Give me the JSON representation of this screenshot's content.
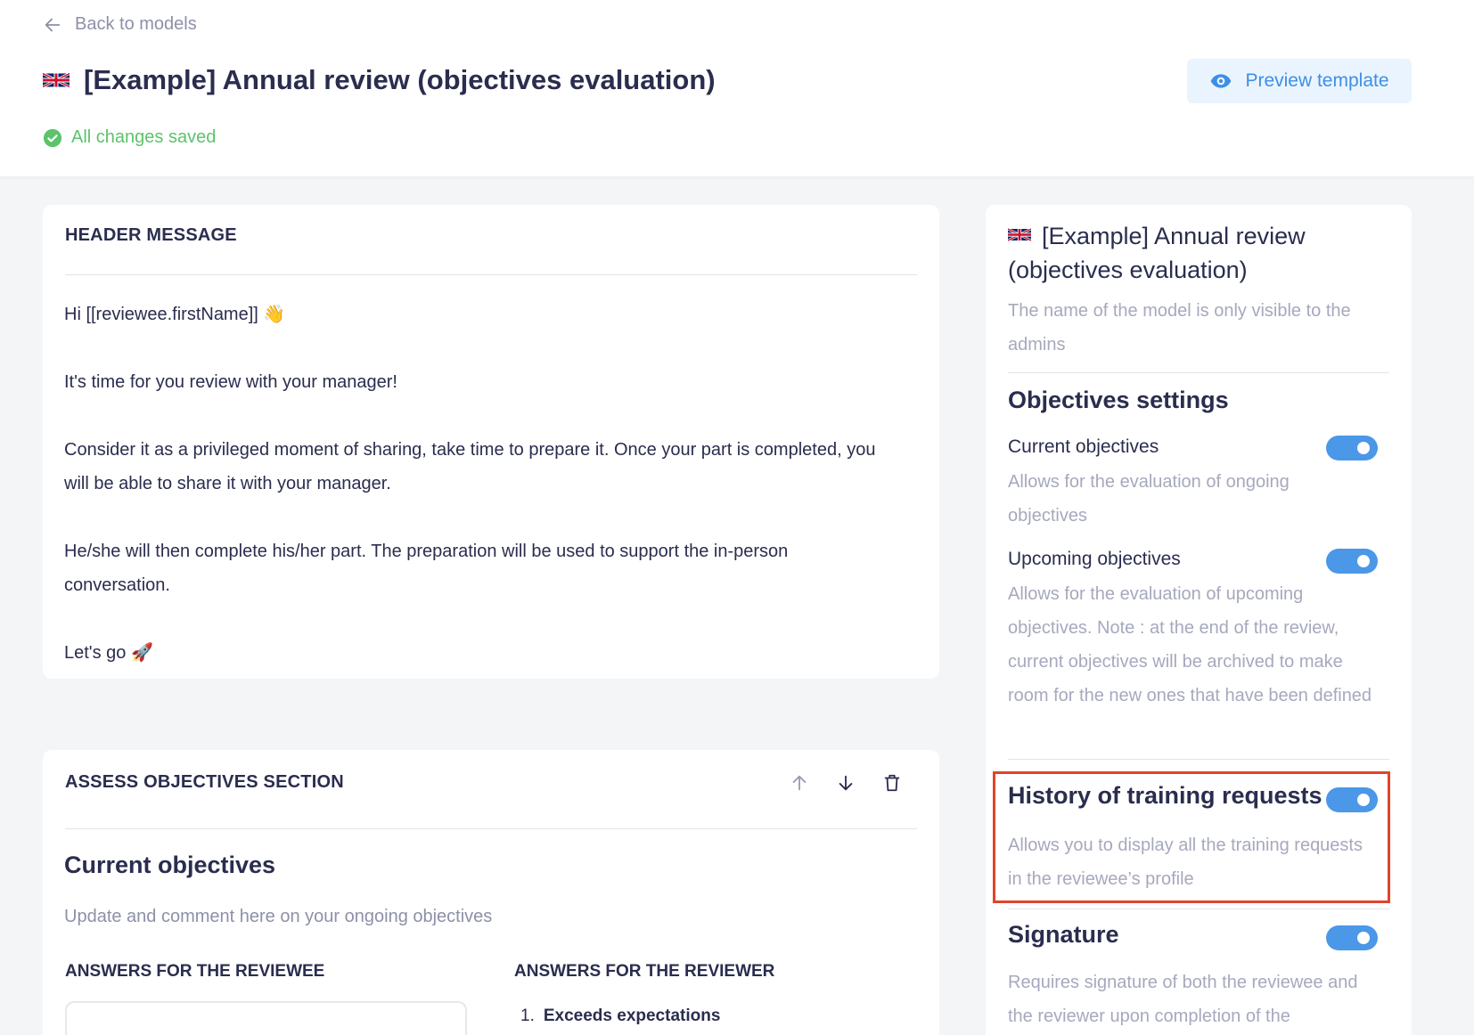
{
  "header": {
    "back_label": "Back to models",
    "title": "[Example] Annual review (objectives evaluation)",
    "status": "All changes saved",
    "preview_label": "Preview template"
  },
  "header_message": {
    "heading": "HEADER MESSAGE",
    "lines": [
      "Hi [[reviewee.firstName]] 👋",
      "It's time for you review with your manager!",
      "Consider it as a privileged moment of sharing, take time to prepare it. Once your part is completed, you will be able to share it with your manager.",
      "He/she will then complete his/her part. The preparation will be used to support the in-person conversation.",
      "Let's go 🚀"
    ]
  },
  "assess_section": {
    "heading": "ASSESS OBJECTIVES SECTION",
    "title": "Current objectives",
    "description": "Update and comment here on your ongoing objectives",
    "reviewee_label": "ANSWERS FOR THE REVIEWEE",
    "reviewer_label": "ANSWERS FOR THE REVIEWER",
    "first_option_number": "1.",
    "first_option": "Exceeds expectations"
  },
  "sidebar": {
    "model_name": "[Example] Annual review (objectives evaluation)",
    "model_note": "The name of the model is only visible to the admins",
    "objectives_heading": "Objectives settings",
    "settings": [
      {
        "label": "Current objectives",
        "description": "Allows for the evaluation of ongoing objectives",
        "enabled": true
      },
      {
        "label": "Upcoming objectives",
        "description": "Allows for the evaluation of upcoming objectives. Note : at the end of the review, current objectives will be archived to make room for the new ones that have been defined",
        "enabled": true
      },
      {
        "label": "History of training requests",
        "description": "Allows you to display all the training requests in the reviewee’s profile",
        "enabled": true
      },
      {
        "label": "Signature",
        "description": "Requires signature of both the reviewee and the reviewer upon completion of the",
        "enabled": true
      }
    ]
  },
  "colors": {
    "accent": "#4b97e8",
    "saved": "#5cc36b",
    "highlight": "#e2432b"
  }
}
